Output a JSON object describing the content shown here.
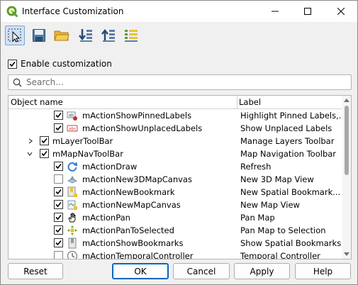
{
  "window": {
    "title": "Interface Customization"
  },
  "toolbar": {
    "buttons": [
      {
        "icon": "select-pointer-icon",
        "active": true
      },
      {
        "icon": "save-icon"
      },
      {
        "icon": "open-folder-icon"
      },
      {
        "icon": "load-from-main-window-icon"
      },
      {
        "icon": "load-from-file-icon"
      },
      {
        "icon": "toggle-all-icon"
      }
    ]
  },
  "enable_customization": {
    "label": "Enable customization",
    "checked": true
  },
  "search": {
    "placeholder": "Search...",
    "value": ""
  },
  "tree": {
    "columns": [
      "Object name",
      "Label"
    ],
    "rows": [
      {
        "name": "mActionShowPinnedLabels",
        "label": "Highlight Pinned Labels,...",
        "checked": true,
        "icon": "pinned-labels-icon"
      },
      {
        "name": "mActionShowUnplacedLabels",
        "label": "Show Unplaced Labels",
        "checked": true,
        "icon": "unplaced-labels-icon"
      },
      {
        "name": "mLayerToolBar",
        "label": "Manage Layers Toolbar",
        "checked": true,
        "expandable": true,
        "expanded": false
      },
      {
        "name": "mMapNavToolBar",
        "label": "Map Navigation Toolbar",
        "checked": true,
        "expandable": true,
        "expanded": true
      },
      {
        "name": "mActionDraw",
        "label": "Refresh",
        "checked": true,
        "icon": "refresh-icon"
      },
      {
        "name": "mActionNew3DMapCanvas",
        "label": "New 3D Map View",
        "checked": false,
        "icon": "new-3d-map-icon"
      },
      {
        "name": "mActionNewBookmark",
        "label": "New Spatial Bookmark...",
        "checked": true,
        "icon": "new-bookmark-icon"
      },
      {
        "name": "mActionNewMapCanvas",
        "label": "New Map View",
        "checked": true,
        "icon": "new-map-view-icon"
      },
      {
        "name": "mActionPan",
        "label": "Pan Map",
        "checked": true,
        "icon": "pan-hand-icon"
      },
      {
        "name": "mActionPanToSelected",
        "label": "Pan Map to Selection",
        "checked": true,
        "icon": "pan-to-selected-icon"
      },
      {
        "name": "mActionShowBookmarks",
        "label": "Show Spatial Bookmarks",
        "checked": true,
        "icon": "show-bookmarks-icon"
      },
      {
        "name": "mActionTemporalController",
        "label": "Temporal Controller",
        "checked": false,
        "icon": "temporal-controller-icon"
      }
    ]
  },
  "buttons": {
    "reset": "Reset",
    "ok": "OK",
    "cancel": "Cancel",
    "apply": "Apply",
    "help": "Help"
  },
  "colors": {
    "accent": "#0067c0",
    "qgis_green": "#5a9e2f"
  }
}
